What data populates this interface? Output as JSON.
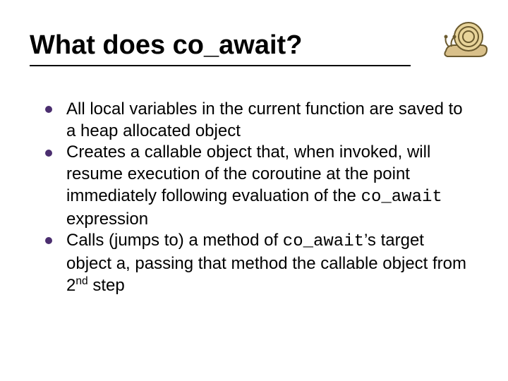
{
  "slide": {
    "title": "What does co_await?",
    "decorative_icon": "snail-icon",
    "bullets": [
      {
        "text": "All local variables in the current function are saved to a heap allocated object"
      },
      {
        "prefix": "Creates a callable object that, when invoked, will resume execution of the coroutine at the point immediately following evaluation of the ",
        "code": "co_await",
        "suffix": " expression"
      },
      {
        "prefix": "Calls (jumps to) a method of ",
        "code": "co_await",
        "mid": "’s target object a, passing that method the callable object from 2",
        "ord_sup": "nd",
        "suffix": " step"
      }
    ]
  }
}
